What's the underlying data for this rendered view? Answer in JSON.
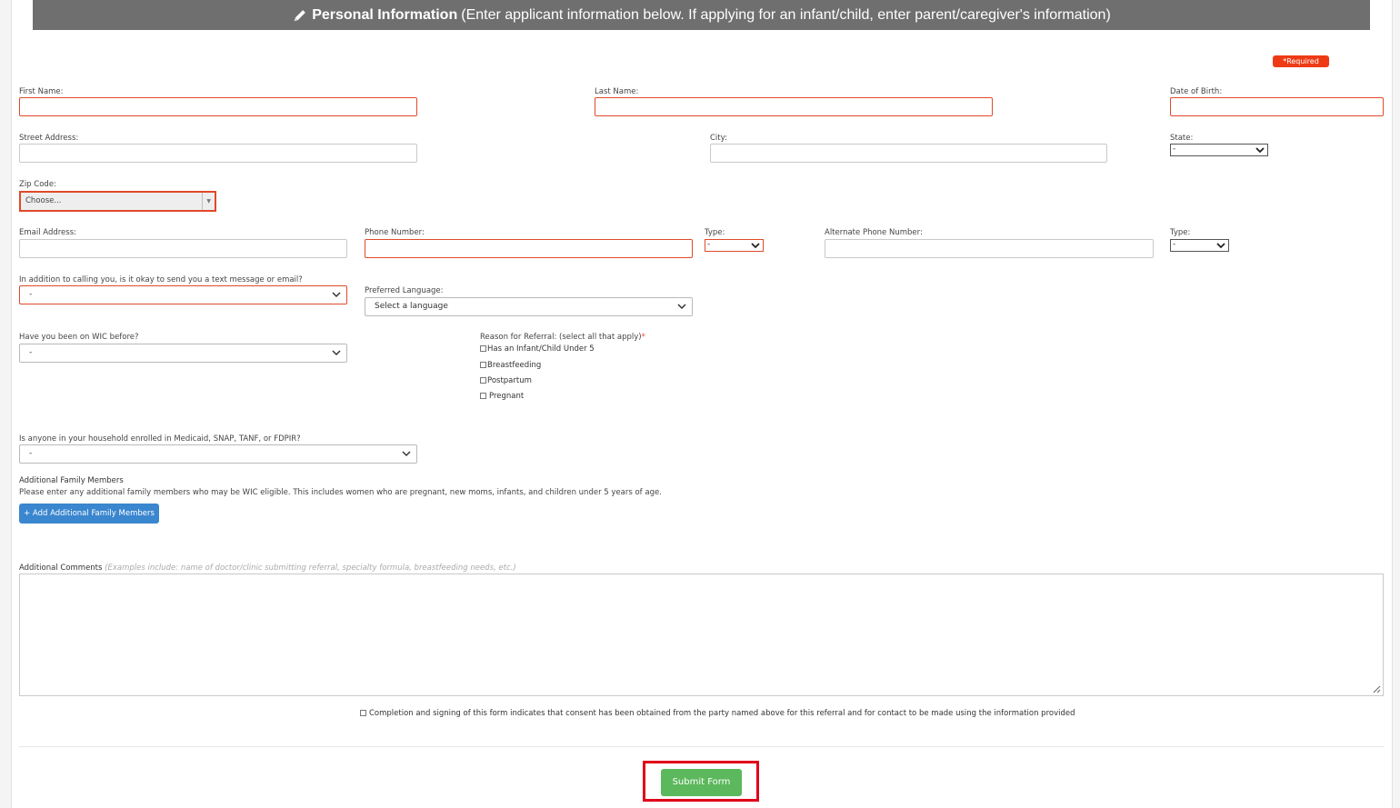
{
  "header": {
    "title": "Personal Information",
    "subtitle": "(Enter applicant information below. If applying for an infant/child, enter parent/caregiver's information)"
  },
  "required_badge": "*Required",
  "fields": {
    "first_name": "First Name:",
    "last_name": "Last Name:",
    "dob": "Date of Birth:",
    "street": "Street Address:",
    "city": "City:",
    "state": "State:",
    "state_value": "-",
    "zip": "Zip Code:",
    "zip_value": "Choose...",
    "email": "Email Address:",
    "phone": "Phone Number:",
    "phone_type": "Type:",
    "phone_type_value": "-",
    "alt_phone": "Alternate Phone Number:",
    "alt_type": "Type:",
    "alt_type_value": "-",
    "text_ok": "In addition to calling you, is it okay to send you a text message or email?",
    "text_ok_value": "-",
    "language": "Preferred Language:",
    "language_value": "Select a language",
    "wic_before": "Have you been on WIC before?",
    "wic_before_value": "-",
    "reason": "Reason for Referral: (select all that apply)",
    "reason_star": "*",
    "reasons": [
      "Has an Infant/Child Under 5",
      "Breastfeeding",
      "Postpartum",
      "Pregnant"
    ],
    "enrolled": "Is anyone in your household enrolled in Medicaid, SNAP, TANF, or FDPIR?",
    "enrolled_value": "-"
  },
  "family": {
    "title": "Additional Family Members",
    "desc": "Please enter any additional family members who may be WIC eligible. This includes women who are pregnant, new moms, infants, and children under 5 years of age.",
    "add_button": "+ Add Additional Family Members"
  },
  "comments": {
    "label": "Additional Comments",
    "hint": "(Examples include: name of doctor/clinic submitting referral, specialty formula, breastfeeding needs, etc.)"
  },
  "consent": "Completion and signing of this form indicates that consent has been obtained from the party named above for this referral and for contact to be made using the information provided",
  "submit": "Submit Form",
  "colors": {
    "header_bg": "#6f6f6f",
    "required": "#ee3b16",
    "primary": "#3a86cf",
    "success": "#5cb85c",
    "highlight": "#e0001a"
  }
}
